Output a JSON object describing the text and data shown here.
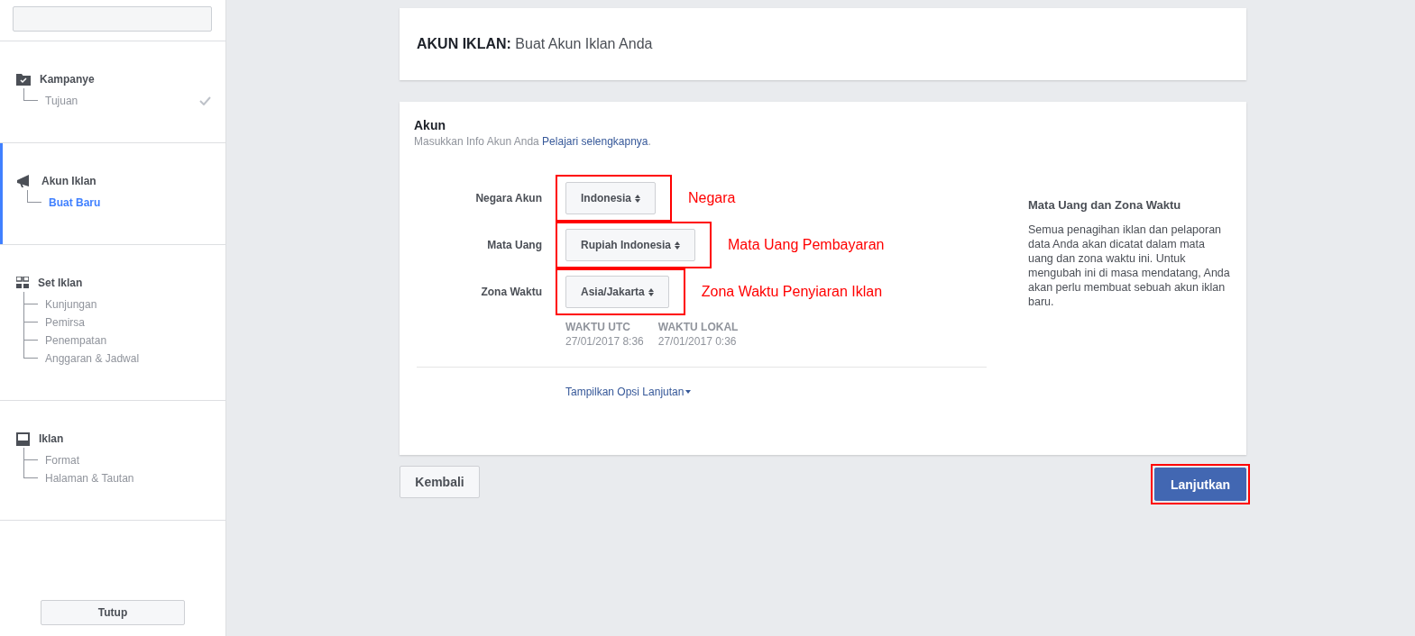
{
  "sidebar": {
    "sections": [
      {
        "title": "Kampanye",
        "selected": false,
        "children": [
          {
            "label": "Tujuan",
            "selected": false,
            "done": true
          }
        ]
      },
      {
        "title": "Akun Iklan",
        "selected": true,
        "children": [
          {
            "label": "Buat Baru",
            "selected": true,
            "done": false
          }
        ]
      },
      {
        "title": "Set Iklan",
        "selected": false,
        "children": [
          {
            "label": "Kunjungan",
            "selected": false,
            "done": false
          },
          {
            "label": "Pemirsa",
            "selected": false,
            "done": false
          },
          {
            "label": "Penempatan",
            "selected": false,
            "done": false
          },
          {
            "label": "Anggaran & Jadwal",
            "selected": false,
            "done": false
          }
        ]
      },
      {
        "title": "Iklan",
        "selected": false,
        "children": [
          {
            "label": "Format",
            "selected": false,
            "done": false
          },
          {
            "label": "Halaman & Tautan",
            "selected": false,
            "done": false
          }
        ]
      }
    ],
    "close_button": "Tutup"
  },
  "header": {
    "label": "AKUN IKLAN:",
    "title": "Buat Akun Iklan Anda"
  },
  "account": {
    "title": "Akun",
    "subtitle": "Masukkan Info Akun Anda",
    "link": "Pelajari selengkapnya",
    "link_suffix": ".",
    "fields": [
      {
        "label": "Negara Akun",
        "value": "Indonesia",
        "highlighted": true,
        "annotation": "Negara"
      },
      {
        "label": "Mata Uang",
        "value": "Rupiah Indonesia",
        "highlighted": true,
        "annotation": "Mata Uang Pembayaran"
      },
      {
        "label": "Zona Waktu",
        "value": "Asia/Jakarta",
        "highlighted": true,
        "annotation": "Zona Waktu Penyiaran Iklan"
      }
    ],
    "times": [
      {
        "label": "WAKTU UTC",
        "value": "27/01/2017 8:36"
      },
      {
        "label": "WAKTU LOKAL",
        "value": "27/01/2017 0:36"
      }
    ],
    "advanced_link": "Tampilkan Opsi Lanjutan",
    "info": {
      "title": "Mata Uang dan Zona Waktu",
      "text": "Semua penagihan iklan dan pelaporan data Anda akan dicatat dalam mata uang dan zona waktu ini. Untuk mengubah ini di masa mendatang, Anda akan perlu membuat sebuah akun iklan baru."
    }
  },
  "footer": {
    "back_button": "Kembali",
    "continue_button": {
      "label": "Lanjutkan",
      "highlighted": true
    }
  }
}
